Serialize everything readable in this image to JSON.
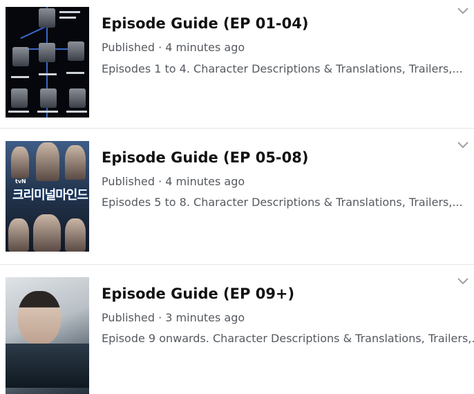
{
  "items": [
    {
      "title": "Episode Guide (EP 01-04)",
      "meta": "Published · 4 minutes ago",
      "description": "Episodes 1 to 4. Character Descriptions & Translations, Trailers,...",
      "thumbnail": "relationship-chart-image"
    },
    {
      "title": "Episode Guide (EP 05-08)",
      "meta": "Published · 4 minutes ago",
      "description": "Episodes 5 to 8. Character Descriptions & Translations, Trailers,...",
      "thumbnail": "drama-poster-image",
      "poster_brand": "tvN",
      "poster_title": "크리미널마인드"
    },
    {
      "title": "Episode Guide (EP 09+)",
      "meta": "Published · 3 minutes ago",
      "description": "Episode 9 onwards. Character Descriptions & Translations, Trailers,...",
      "thumbnail": "actor-portrait-image"
    }
  ],
  "icons": {
    "expand": "chevron-down-icon"
  },
  "colors": {
    "title": "#111111",
    "meta": "#555a60",
    "divider": "#e3e3e3",
    "chevron": "#9aa0a6"
  }
}
